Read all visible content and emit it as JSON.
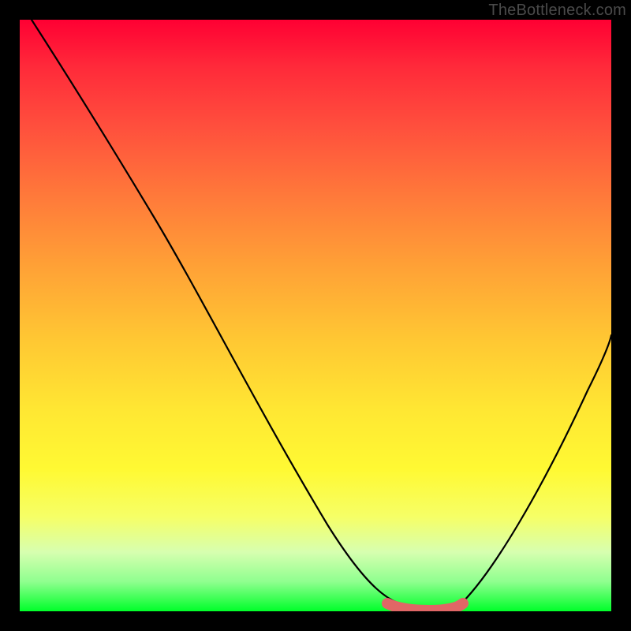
{
  "watermark": "TheBottleneck.com",
  "chart_data": {
    "type": "line",
    "title": "",
    "xlabel": "",
    "ylabel": "",
    "xlim": [
      0,
      100
    ],
    "ylim": [
      0,
      100
    ],
    "grid": false,
    "series": [
      {
        "name": "left-descending-curve",
        "x": [
          2,
          7,
          12,
          18,
          24,
          30,
          36,
          42,
          48,
          54,
          58,
          62,
          65,
          66.5
        ],
        "y": [
          100,
          92,
          84,
          75,
          66,
          57,
          48,
          39,
          30,
          21,
          14,
          8,
          3,
          0.8
        ]
      },
      {
        "name": "valley-floor",
        "x": [
          63,
          65,
          67,
          69,
          71,
          73,
          74.5
        ],
        "y": [
          1.2,
          0.6,
          0.4,
          0.4,
          0.5,
          0.8,
          1.4
        ]
      },
      {
        "name": "right-ascending-curve",
        "x": [
          74.5,
          78,
          82,
          86,
          90,
          94,
          98,
          100
        ],
        "y": [
          1.4,
          6,
          13,
          21,
          30,
          40,
          50,
          56
        ]
      }
    ],
    "annotations": [
      {
        "name": "valley-marker",
        "type": "thick-segment",
        "color": "#e57373",
        "x": [
          62,
          75
        ],
        "y": [
          1.2,
          1.4
        ]
      }
    ],
    "background": {
      "type": "vertical-gradient",
      "stops": [
        {
          "pos": 0,
          "color": "#ff0033"
        },
        {
          "pos": 50,
          "color": "#ffcc33"
        },
        {
          "pos": 80,
          "color": "#ffff55"
        },
        {
          "pos": 100,
          "color": "#00ff2a"
        }
      ]
    }
  }
}
